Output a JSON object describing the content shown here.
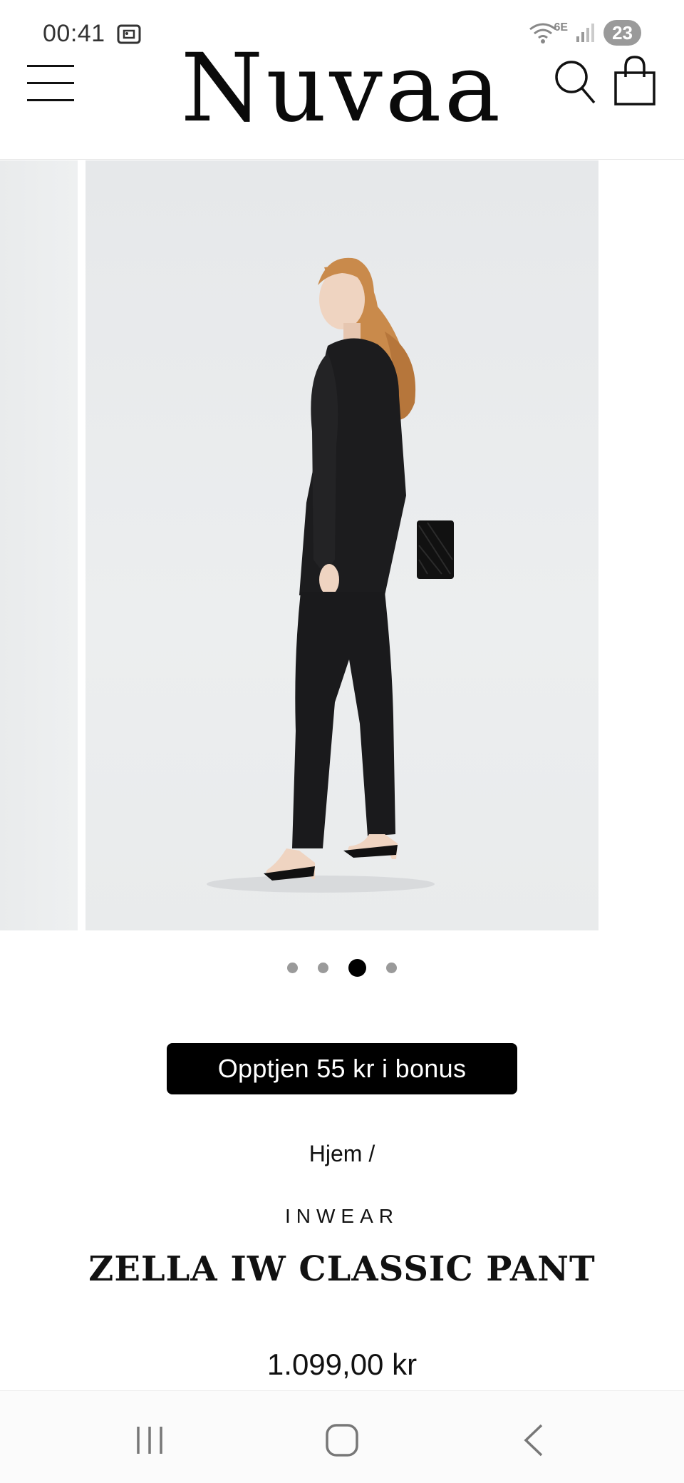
{
  "status_bar": {
    "time": "00:41",
    "network": "6E",
    "battery": "23"
  },
  "header": {
    "logo": "Nuvaa",
    "menu_icon": "hamburger-menu-icon",
    "search_icon": "search-icon",
    "cart_icon": "shopping-bag-icon"
  },
  "gallery": {
    "slide_count": 4,
    "active_slide": 3,
    "zoom_icon": "zoom-icon"
  },
  "bonus_badge": "Opptjen 55 kr i bonus",
  "breadcrumb": "Hjem /",
  "product": {
    "brand": "INWEAR",
    "title": "ZELLA IW CLASSIC PANT",
    "price": "1.099,00 kr"
  },
  "nav_bar": {
    "recents_icon": "recents-icon",
    "home_icon": "home-icon",
    "back_icon": "back-icon"
  }
}
